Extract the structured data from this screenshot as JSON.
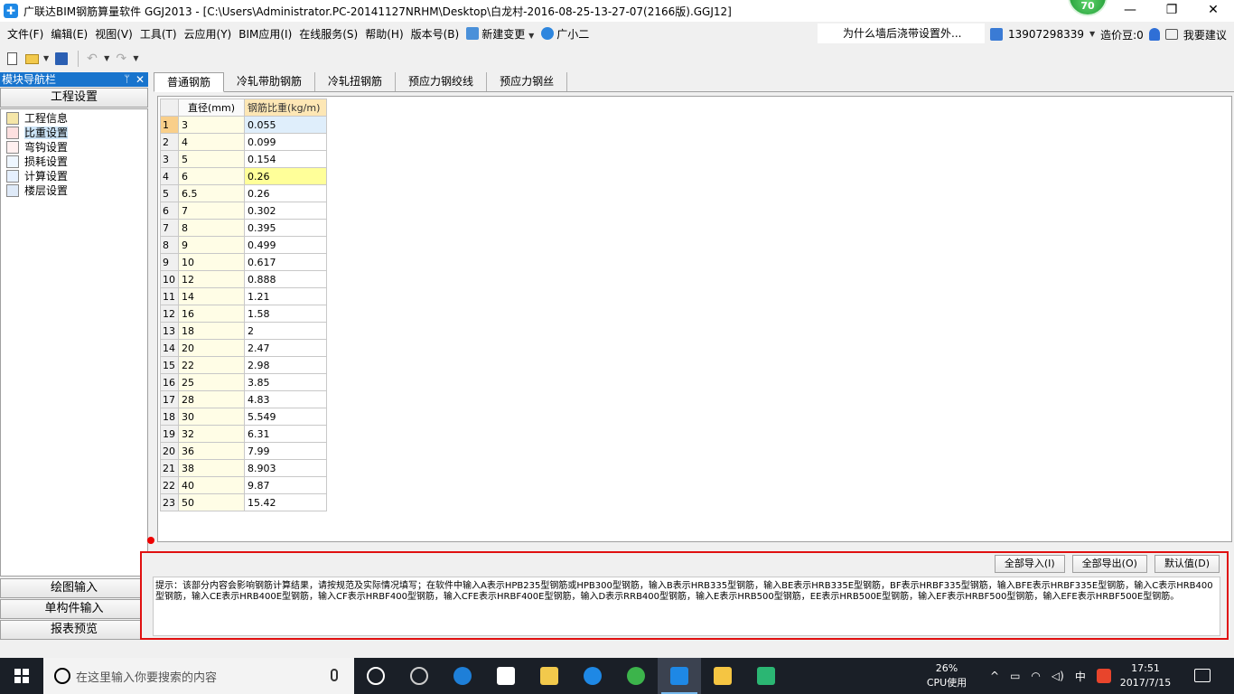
{
  "window": {
    "title": "广联达BIM钢筋算量软件 GGJ2013 - [C:\\Users\\Administrator.PC-20141127NRHM\\Desktop\\白龙村-2016-08-25-13-27-07(2166版).GGJ12]",
    "badge_value": "70",
    "minimize": "—",
    "maximize": "❐",
    "close": "✕"
  },
  "menu": {
    "items": [
      "文件(F)",
      "编辑(E)",
      "视图(V)",
      "工具(T)",
      "云应用(Y)",
      "BIM应用(I)",
      "在线服务(S)",
      "帮助(H)",
      "版本号(B)"
    ],
    "new_change": "新建变更",
    "assistant": "广小二",
    "hint": "为什么墙后浇带设置外...",
    "phone": "13907298339",
    "beans": "造价豆:0",
    "suggest": "我要建议"
  },
  "nav": {
    "header": "模块导航栏",
    "pin": "ᛘ",
    "close": "✕",
    "section": "工程设置",
    "items": [
      {
        "label": "工程信息",
        "icon": "folder-icon"
      },
      {
        "label": "比重设置",
        "icon": "weight-icon"
      },
      {
        "label": "弯钩设置",
        "icon": "hook-icon"
      },
      {
        "label": "损耗设置",
        "icon": "loss-icon"
      },
      {
        "label": "计算设置",
        "icon": "calc-icon"
      },
      {
        "label": "楼层设置",
        "icon": "floor-icon"
      }
    ],
    "bottom": [
      "绘图输入",
      "单构件输入",
      "报表预览"
    ]
  },
  "tabs": [
    "普通钢筋",
    "冷轧带肋钢筋",
    "冷轧扭钢筋",
    "预应力钢绞线",
    "预应力钢丝"
  ],
  "table": {
    "headers": {
      "diameter": "直径(mm)",
      "weight": "钢筋比重(kg/m)"
    },
    "rows": [
      {
        "idx": "1",
        "d": "3",
        "w": "0.055"
      },
      {
        "idx": "2",
        "d": "4",
        "w": "0.099"
      },
      {
        "idx": "3",
        "d": "5",
        "w": "0.154"
      },
      {
        "idx": "4",
        "d": "6",
        "w": "0.26"
      },
      {
        "idx": "5",
        "d": "6.5",
        "w": "0.26"
      },
      {
        "idx": "6",
        "d": "7",
        "w": "0.302"
      },
      {
        "idx": "7",
        "d": "8",
        "w": "0.395"
      },
      {
        "idx": "8",
        "d": "9",
        "w": "0.499"
      },
      {
        "idx": "9",
        "d": "10",
        "w": "0.617"
      },
      {
        "idx": "10",
        "d": "12",
        "w": "0.888"
      },
      {
        "idx": "11",
        "d": "14",
        "w": "1.21"
      },
      {
        "idx": "12",
        "d": "16",
        "w": "1.58"
      },
      {
        "idx": "13",
        "d": "18",
        "w": "2"
      },
      {
        "idx": "14",
        "d": "20",
        "w": "2.47"
      },
      {
        "idx": "15",
        "d": "22",
        "w": "2.98"
      },
      {
        "idx": "16",
        "d": "25",
        "w": "3.85"
      },
      {
        "idx": "17",
        "d": "28",
        "w": "4.83"
      },
      {
        "idx": "18",
        "d": "30",
        "w": "5.549"
      },
      {
        "idx": "19",
        "d": "32",
        "w": "6.31"
      },
      {
        "idx": "20",
        "d": "36",
        "w": "7.99"
      },
      {
        "idx": "21",
        "d": "38",
        "w": "8.903"
      },
      {
        "idx": "22",
        "d": "40",
        "w": "9.87"
      },
      {
        "idx": "23",
        "d": "50",
        "w": "15.42"
      }
    ]
  },
  "hint_panel": {
    "import_all": "全部导入(I)",
    "export_all": "全部导出(O)",
    "default": "默认值(D)",
    "text": "提示：该部分内容会影响钢筋计算结果，请按规范及实际情况填写；在软件中输入A表示HPB235型钢筋或HPB300型钢筋，输入B表示HRB335型钢筋，输入BE表示HRB335E型钢筋，BF表示HRBF335型钢筋，输入BFE表示HRBF335E型钢筋，输入C表示HRB400型钢筋，输入CE表示HRB400E型钢筋，输入CF表示HRBF400型钢筋，输入CFE表示HRBF400E型钢筋，输入D表示RRB400型钢筋，输入E表示HRB500型钢筋，EE表示HRB500E型钢筋，输入EF表示HRBF500型钢筋，输入EFE表示HRBF500E型钢筋。"
  },
  "taskbar": {
    "search_placeholder": "在这里输入你要搜索的内容",
    "cpu_percent": "26%",
    "cpu_label": "CPU使用",
    "ime": "中",
    "time": "17:51",
    "date": "2017/7/15"
  },
  "colors": {
    "nav_header": "#1874cd",
    "highlight_border": "#e01010",
    "taskbar": "#1a1f27"
  }
}
